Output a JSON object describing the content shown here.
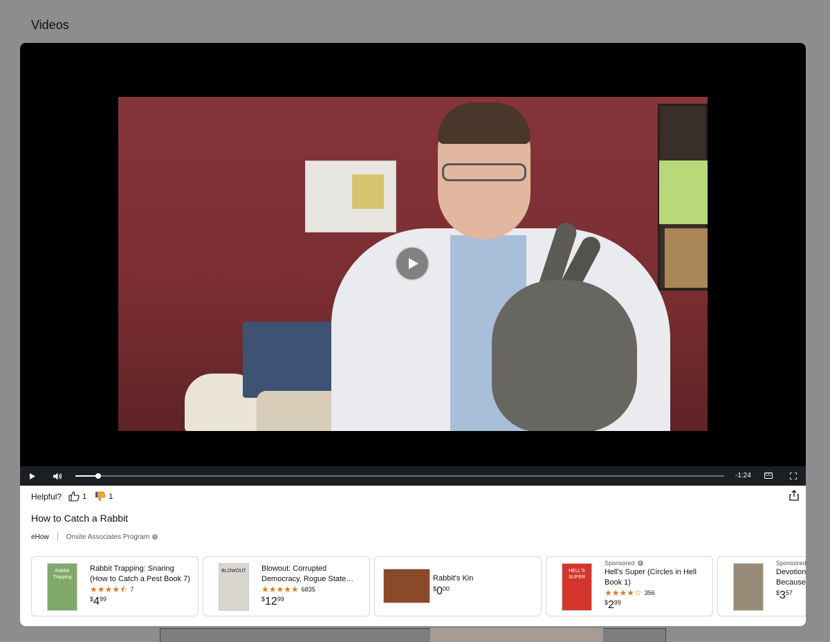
{
  "background": {
    "section_title": "Videos"
  },
  "player": {
    "time_remaining": "-1:24",
    "progress_fraction": 0.035,
    "cc_label": "CC"
  },
  "info": {
    "helpful_label": "Helpful?",
    "thumbs_up_count": "1",
    "thumbs_down_count": "1",
    "title": "How to Catch a Rabbit",
    "source": "eHow",
    "program": "Onsite Associates Program"
  },
  "products": [
    {
      "sponsored": "",
      "title": "Rabbit Trapping: Snaring (How to Catch a Pest Book 7)",
      "stars": "★★★★⯪",
      "rating_count": "7",
      "price_whole": "4",
      "price_frac": "99",
      "cover_color": "#7fa86a",
      "cover_text": "Rabbit Trapping"
    },
    {
      "sponsored": "",
      "title": "Blowout: Corrupted Democracy, Rogue State…",
      "stars": "★★★★★",
      "rating_count": "6835",
      "price_whole": "12",
      "price_frac": "99",
      "cover_color": "#d9d6cf",
      "cover_text": "BLOWOUT"
    },
    {
      "sponsored": "",
      "title": "Rabbit's Kin",
      "stars": "",
      "rating_count": "",
      "price_whole": "0",
      "price_frac": "00",
      "cover_color": "#8a4a2a",
      "cover_text": ""
    },
    {
      "sponsored": "Sponsored",
      "title": "Hell's Super (Circles in Hell Book 1)",
      "stars": "★★★★☆",
      "rating_count": "356",
      "price_whole": "2",
      "price_frac": "99",
      "cover_color": "#d6352b",
      "cover_text": "HELL'S SUPER"
    },
    {
      "sponsored": "Sponsored",
      "title": "Devotion Because",
      "stars": "",
      "rating_count": "",
      "price_whole": "3",
      "price_frac": "57",
      "cover_color": "#9a8a78",
      "cover_text": ""
    }
  ]
}
